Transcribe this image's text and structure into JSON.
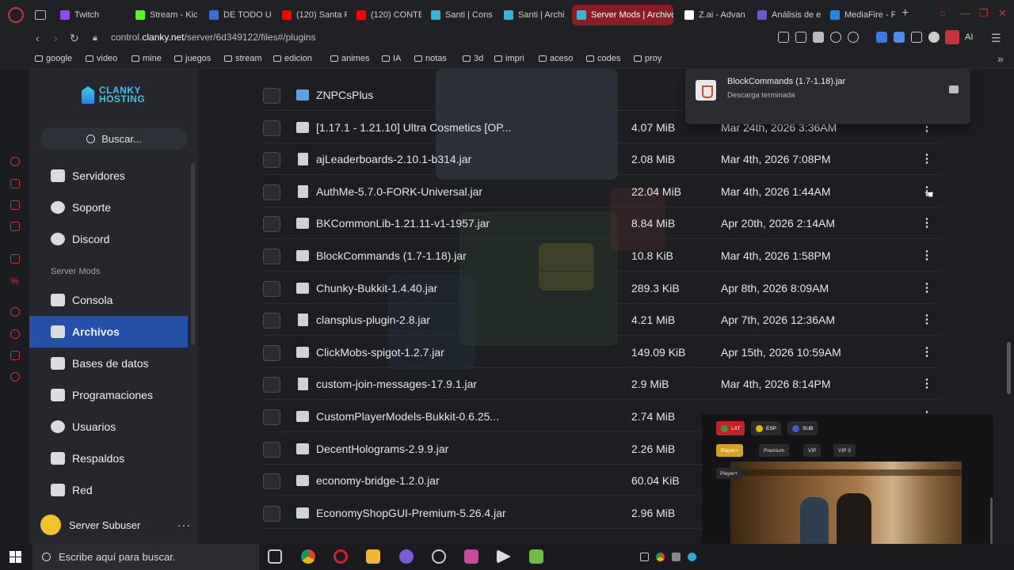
{
  "browser": {
    "tabs": [
      {
        "label": "Twitch",
        "color": "#9146ff",
        "active": false
      },
      {
        "label": "Stream - Kic",
        "color": "#53fc18",
        "active": false
      },
      {
        "label": "DE TODO U",
        "color": "#3b6fd6",
        "active": false
      },
      {
        "label": "(120) Santa F",
        "color": "#ff0000",
        "active": false
      },
      {
        "label": "(120) CONTE",
        "color": "#ff0000",
        "active": false
      },
      {
        "label": "Santi | Cons",
        "color": "#35b6d8",
        "active": false
      },
      {
        "label": "Santi | Archi",
        "color": "#35b6d8",
        "active": false
      },
      {
        "label": "Server Mods | Archivo",
        "color": "#35b6d8",
        "active": true
      },
      {
        "label": "Z.ai - Advan",
        "color": "#ffffff",
        "active": false
      },
      {
        "label": "Análisis de e",
        "color": "#6a5acd",
        "active": false
      },
      {
        "label": "MediaFire - F",
        "color": "#1e88e5",
        "active": false
      }
    ],
    "url_prefix": "control.",
    "url_host": "clanky.net",
    "url_path": "/server/6d349122/files#/plugins",
    "ai_label": "AI",
    "bookmarks": [
      "google",
      "video",
      "mine",
      "juegos",
      "stream",
      "edicion",
      "animes",
      "IA",
      "notas",
      "3d",
      "impri",
      "aceso",
      "codes",
      "proy"
    ]
  },
  "sidebar": {
    "logo_line1": "CLANKY",
    "logo_line2": "HOSTING",
    "search_placeholder": "Buscar...",
    "items_top": [
      {
        "label": "Servidores",
        "icon": "server-icon"
      },
      {
        "label": "Soporte",
        "icon": "support-icon"
      },
      {
        "label": "Discord",
        "icon": "discord-icon"
      }
    ],
    "section_label": "Server Mods",
    "items_server": [
      {
        "label": "Consola",
        "icon": "terminal-icon",
        "active": false
      },
      {
        "label": "Archivos",
        "icon": "folder-icon",
        "active": true
      },
      {
        "label": "Bases de datos",
        "icon": "database-icon",
        "active": false
      },
      {
        "label": "Programaciones",
        "icon": "calendar-icon",
        "active": false
      },
      {
        "label": "Usuarios",
        "icon": "users-icon",
        "active": false
      },
      {
        "label": "Respaldos",
        "icon": "archive-icon",
        "active": false
      },
      {
        "label": "Red",
        "icon": "network-icon",
        "active": false
      }
    ],
    "user_label": "Server Subuser",
    "user_menu": "···"
  },
  "files": [
    {
      "name": "ZNPCsPlus",
      "size": "",
      "date": "",
      "type": "folder"
    },
    {
      "name": "[1.17.1 - 1.21.10] Ultra Cosmetics [OP...",
      "size": "4.07 MiB",
      "date": "Mar 24th, 2026 3:36AM",
      "type": "archive"
    },
    {
      "name": "ajLeaderboards-2.10.1-b314.jar",
      "size": "2.08 MiB",
      "date": "Mar 4th, 2026 7:08PM",
      "type": "doc"
    },
    {
      "name": "AuthMe-5.7.0-FORK-Universal.jar",
      "size": "22.04 MiB",
      "date": "Mar 4th, 2026 1:44AM",
      "type": "doc"
    },
    {
      "name": "BKCommonLib-1.21.11-v1-1957.jar",
      "size": "8.84 MiB",
      "date": "Apr 20th, 2026 2:14AM",
      "type": "archive"
    },
    {
      "name": "BlockCommands (1.7-1.18).jar",
      "size": "10.8 KiB",
      "date": "Mar 4th, 2026 1:58PM",
      "type": "archive"
    },
    {
      "name": "Chunky-Bukkit-1.4.40.jar",
      "size": "289.3 KiB",
      "date": "Apr 8th, 2026 8:09AM",
      "type": "archive"
    },
    {
      "name": "clansplus-plugin-2.8.jar",
      "size": "4.21 MiB",
      "date": "Apr 7th, 2026 12:36AM",
      "type": "doc"
    },
    {
      "name": "ClickMobs-spigot-1.2.7.jar",
      "size": "149.09 KiB",
      "date": "Apr 15th, 2026 10:59AM",
      "type": "archive"
    },
    {
      "name": "custom-join-messages-17.9.1.jar",
      "size": "2.9 MiB",
      "date": "Mar 4th, 2026 8:14PM",
      "type": "doc"
    },
    {
      "name": "CustomPlayerModels-Bukkit-0.6.25...",
      "size": "2.74 MiB",
      "date": "",
      "type": "archive"
    },
    {
      "name": "DecentHolograms-2.9.9.jar",
      "size": "2.26 MiB",
      "date": "",
      "type": "archive"
    },
    {
      "name": "economy-bridge-1.2.0.jar",
      "size": "60.04 KiB",
      "date": "",
      "type": "archive"
    },
    {
      "name": "EconomyShopGUI-Premium-5.26.4.jar",
      "size": "2.96 MiB",
      "date": "",
      "type": "archive"
    }
  ],
  "download": {
    "filename": "BlockCommands (1.7-1.18).jar",
    "status": "Descarga terminada"
  },
  "video": {
    "langs": [
      "LAT",
      "ESP",
      "SUB"
    ],
    "qualities": [
      "Player+",
      "Premium",
      "VIP",
      "VIP 3"
    ],
    "player_tag": "Player+"
  },
  "taskbar": {
    "search_placeholder": "Escribe aquí para buscar."
  }
}
